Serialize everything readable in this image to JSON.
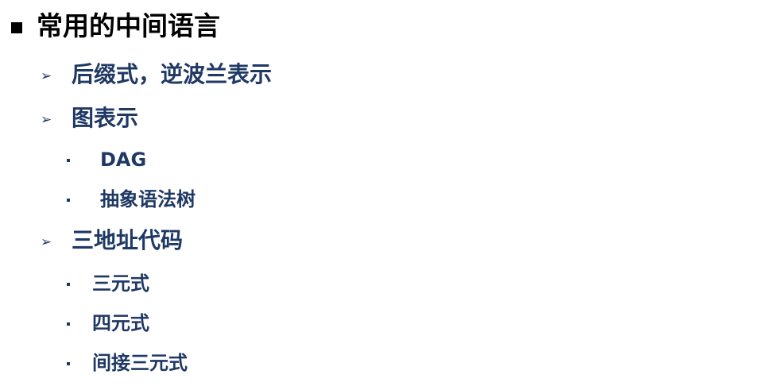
{
  "heading": {
    "bullet_icon": "square-bullet-icon",
    "text": "常用的中间语言"
  },
  "items": [
    {
      "bullet_icon": "arrowhead-bullet-icon",
      "text": "后缀式，逆波兰表示"
    },
    {
      "bullet_icon": "arrowhead-bullet-icon",
      "text": "图表示",
      "subitems": [
        {
          "bullet_icon": "dot-bullet-icon",
          "text": "DAG"
        },
        {
          "bullet_icon": "dot-bullet-icon",
          "text": "抽象语法树"
        }
      ]
    },
    {
      "bullet_icon": "arrowhead-bullet-icon",
      "text": "三地址代码",
      "subitems": [
        {
          "bullet_icon": "dot-bullet-icon",
          "text": "三元式"
        },
        {
          "bullet_icon": "dot-bullet-icon",
          "text": "四元式"
        },
        {
          "bullet_icon": "dot-bullet-icon",
          "text": "间接三元式"
        }
      ]
    }
  ],
  "colors": {
    "heading": "#000000",
    "body": "#1f3864",
    "background": "#ffffff"
  }
}
